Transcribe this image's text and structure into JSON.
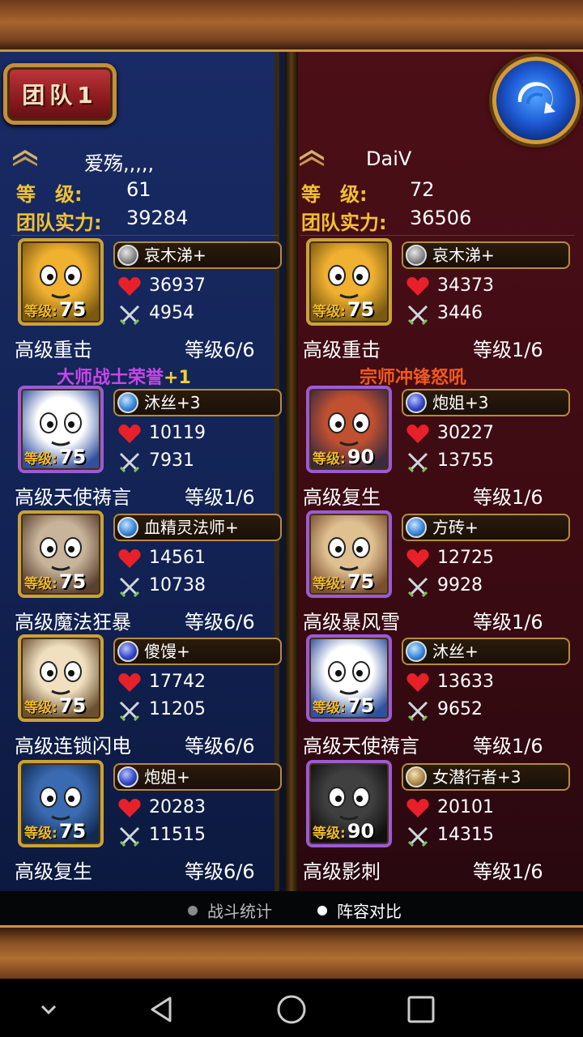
{
  "header": {
    "team_label": "团队1"
  },
  "left_team": {
    "name": "爱殇,,,,,",
    "level_label": "等　级:",
    "level": "61",
    "power_label": "团队实力:",
    "power": "39284",
    "heroes": [
      {
        "name": "哀木涕+",
        "hp": "36937",
        "atk": "4954",
        "level_label": "等级:",
        "level": "75",
        "skill": "高级重击",
        "skill_level": "等级6/6",
        "gem": "gray"
      },
      {
        "name": "沐丝+3",
        "hp": "10119",
        "atk": "7931",
        "level_label": "等级:",
        "level": "75",
        "skill": "高级天使祷言",
        "skill_level": "等级1/6",
        "gem": "blue"
      },
      {
        "name": "血精灵法师+",
        "hp": "14561",
        "atk": "10738",
        "level_label": "等级:",
        "level": "75",
        "skill": "高级魔法狂暴",
        "skill_level": "等级6/6",
        "gem": "blue"
      },
      {
        "name": "傻馒+",
        "hp": "17742",
        "atk": "11205",
        "level_label": "等级:",
        "level": "75",
        "skill": "高级连锁闪电",
        "skill_level": "等级6/6",
        "gem": "navy"
      },
      {
        "name": "炮姐+",
        "hp": "20283",
        "atk": "11515",
        "level_label": "等级:",
        "level": "75",
        "skill": "高级复生",
        "skill_level": "等级6/6",
        "gem": "navy"
      }
    ],
    "honor_title": "大师战士荣誉",
    "honor_bonus": "+1"
  },
  "right_team": {
    "name": "DaiV",
    "level_label": "等　级:",
    "level": "72",
    "power_label": "团队实力:",
    "power": "36506",
    "heroes": [
      {
        "name": "哀木涕+",
        "hp": "34373",
        "atk": "3446",
        "level_label": "等级:",
        "level": "75",
        "skill": "高级重击",
        "skill_level": "等级1/6",
        "gem": "gray"
      },
      {
        "name": "炮姐+3",
        "hp": "30227",
        "atk": "13755",
        "level_label": "等级:",
        "level": "90",
        "skill": "高级复生",
        "skill_level": "等级1/6",
        "gem": "navy"
      },
      {
        "name": "方砖+",
        "hp": "12725",
        "atk": "9928",
        "level_label": "等级:",
        "level": "75",
        "skill": "高级暴风雪",
        "skill_level": "等级1/6",
        "gem": "blue"
      },
      {
        "name": "沐丝+",
        "hp": "13633",
        "atk": "9652",
        "level_label": "等级:",
        "level": "75",
        "skill": "高级天使祷言",
        "skill_level": "等级1/6",
        "gem": "blue"
      },
      {
        "name": "女潜行者+3",
        "hp": "20101",
        "atk": "14315",
        "level_label": "等级:",
        "level": "90",
        "skill": "高级影刺",
        "skill_level": "等级1/6",
        "gem": "tan"
      }
    ],
    "honor_title": "宗师冲锋怒吼"
  },
  "tabs": [
    {
      "label": "战斗统计",
      "active": false
    },
    {
      "label": "阵容对比",
      "active": true
    }
  ],
  "colors": {
    "gold": "#f2c230",
    "honor_left": "#c846e8",
    "honor_right": "#f05a1e",
    "honor_bonus": "#f2d030"
  },
  "icons": [
    "rank-chevron-icon",
    "back-arrow-icon",
    "heart-icon",
    "crossed-swords-icon",
    "gem-icon",
    "nav-back-icon",
    "nav-home-icon",
    "nav-recents-icon",
    "nav-collapse-icon"
  ]
}
